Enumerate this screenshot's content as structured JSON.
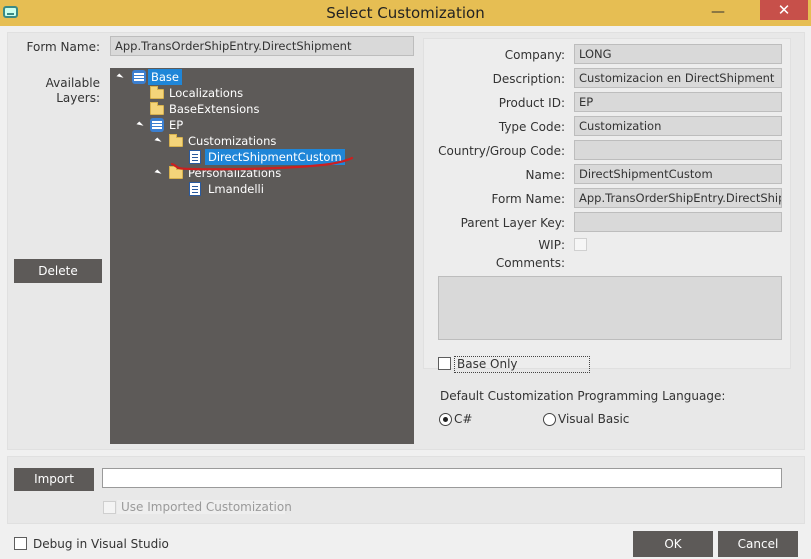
{
  "window": {
    "title": "Select Customization",
    "minimize_glyph": "—",
    "close_glyph": "✕",
    "icon": "app-window-icon"
  },
  "left": {
    "form_name_label": "Form Name:",
    "form_name_value": "App.TransOrderShipEntry.DirectShipment",
    "available_layers_label_1": "Available",
    "available_layers_label_2": "Layers:",
    "delete_button": "Delete",
    "tree": {
      "base": "Base",
      "localizations": "Localizations",
      "base_extensions": "BaseExtensions",
      "ep": "EP",
      "customizations": "Customizations",
      "direct_shipment_custom": "DirectShipmentCustom",
      "personalizations": "Personalizations",
      "lmandelli": "Lmandelli"
    },
    "annotation_color": "#cc1f1f"
  },
  "details": {
    "company_label": "Company:",
    "company_value": "LONG",
    "description_label": "Description:",
    "description_value": "Customizacion en DirectShipment",
    "product_id_label": "Product ID:",
    "product_id_value": "EP",
    "type_code_label": "Type Code:",
    "type_code_value": "Customization",
    "country_group_label": "Country/Group Code:",
    "country_group_value": "",
    "name_label": "Name:",
    "name_value": "DirectShipmentCustom",
    "form_name_label": "Form Name:",
    "form_name_value": "App.TransOrderShipEntry.DirectShipme",
    "parent_layer_label": "Parent Layer Key:",
    "parent_layer_value": "",
    "wip_label": "WIP:",
    "comments_label": "Comments:",
    "comments_value": ""
  },
  "options": {
    "base_only_label": "Base Only",
    "language_label": "Default Customization Programming Language:",
    "csharp_label": "C#",
    "vb_label": "Visual Basic"
  },
  "import": {
    "import_button": "Import",
    "import_path_value": "",
    "use_imported_label": "Use Imported Customization"
  },
  "footer": {
    "debug_label": "Debug in Visual Studio",
    "ok_button": "OK",
    "cancel_button": "Cancel"
  }
}
